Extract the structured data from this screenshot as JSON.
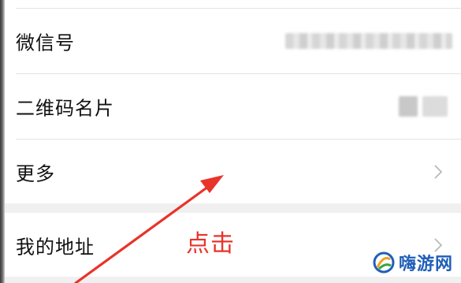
{
  "settings_list": {
    "rows": [
      {
        "label": "微信号",
        "has_chevron": false
      },
      {
        "label": "二维码名片",
        "has_chevron": false
      },
      {
        "label": "更多",
        "has_chevron": true
      }
    ],
    "address_row": {
      "label": "我的地址",
      "has_chevron": true
    }
  },
  "annotation": {
    "click_label": "点击",
    "color": "#e8342a"
  },
  "watermark": {
    "text": "嗨游网",
    "color": "#1f5fb8"
  },
  "colors": {
    "background": "#f0f0f0",
    "row_background": "#ffffff",
    "text": "#111111",
    "chevron": "#b5b5b5"
  }
}
